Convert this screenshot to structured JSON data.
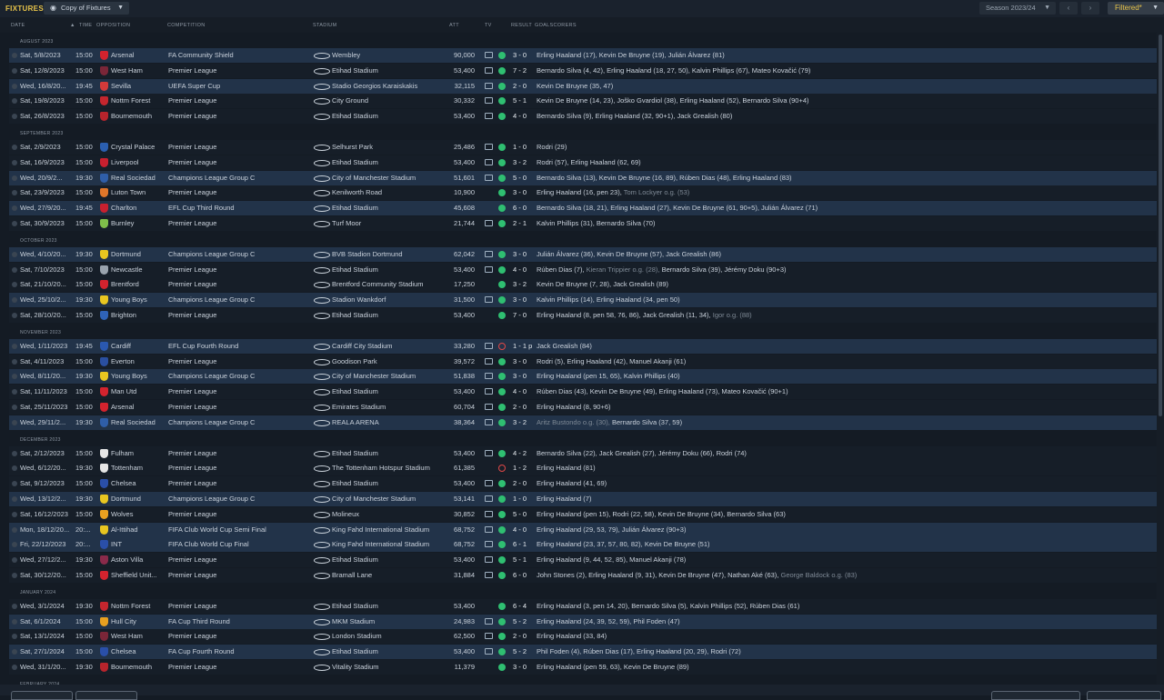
{
  "header": {
    "title": "FIXTURES",
    "view_selector": "Copy of Fixtures",
    "season_selector": "Season 2023/24",
    "filter_button": "Filtered*"
  },
  "columns": {
    "date": "DATE",
    "time": "TIME",
    "opposition": "OPPOSITION",
    "competition": "COMPETITION",
    "stadium": "STADIUM",
    "attendance": "ATT",
    "tv": "TV",
    "result": "RESULT",
    "goalscorers": "GOALSCORERS"
  },
  "months": [
    {
      "label": "AUGUST 2023",
      "fixtures": [
        {
          "date": "Sat, 5/8/2023",
          "time": "15:00",
          "opp": "Arsenal",
          "crest": "#d3232e",
          "comp": "FA Community Shield",
          "stadium": "Wembley",
          "att": "90,000",
          "tv": true,
          "outcome": "w",
          "score": "3 - 0",
          "scorers": "Erling Haaland (17), Kevin De Bruyne (19), Julián Álvarez (81)",
          "og": "",
          "scorers2": "",
          "hl": true
        },
        {
          "date": "Sat, 12/8/2023",
          "time": "15:00",
          "opp": "West Ham",
          "crest": "#7a2638",
          "comp": "Premier League",
          "stadium": "Etihad Stadium",
          "att": "53,400",
          "tv": true,
          "outcome": "w",
          "score": "7 - 2",
          "scorers": "Bernardo Silva (4, 42), Erling Haaland (18, 27, 50), Kalvin Phillips (67), Mateo Kovačić (79)",
          "og": "",
          "scorers2": "",
          "hl": false
        },
        {
          "date": "Wed, 16/8/20...",
          "time": "19:45",
          "opp": "Sevilla",
          "crest": "#d33a3a",
          "comp": "UEFA Super Cup",
          "stadium": "Stadio Georgios Karaiskakis",
          "att": "32,115",
          "tv": true,
          "outcome": "w",
          "score": "2 - 0",
          "scorers": "Kevin De Bruyne (35, 47)",
          "og": "",
          "scorers2": "",
          "hl": true
        },
        {
          "date": "Sat, 19/8/2023",
          "time": "15:00",
          "opp": "Nottm Forest",
          "crest": "#c4262e",
          "comp": "Premier League",
          "stadium": "City Ground",
          "att": "30,332",
          "tv": true,
          "outcome": "w",
          "score": "5 - 1",
          "scorers": "Kevin De Bruyne (14, 23), Joško Gvardiol (38), Erling Haaland (52), Bernardo Silva (90+4)",
          "og": "",
          "scorers2": "",
          "hl": false
        },
        {
          "date": "Sat, 26/8/2023",
          "time": "15:00",
          "opp": "Bournemouth",
          "crest": "#b8242c",
          "comp": "Premier League",
          "stadium": "Etihad Stadium",
          "att": "53,400",
          "tv": true,
          "outcome": "w",
          "score": "4 - 0",
          "scorers": "Bernardo Silva (9), Erling Haaland (32, 90+1), Jack Grealish (80)",
          "og": "",
          "scorers2": "",
          "hl": false
        }
      ]
    },
    {
      "label": "SEPTEMBER 2023",
      "fixtures": [
        {
          "date": "Sat, 2/9/2023",
          "time": "15:00",
          "opp": "Crystal Palace",
          "crest": "#2b5fb0",
          "comp": "Premier League",
          "stadium": "Selhurst Park",
          "att": "25,486",
          "tv": true,
          "outcome": "w",
          "score": "1 - 0",
          "scorers": "Rodri (29)",
          "og": "",
          "scorers2": "",
          "hl": false
        },
        {
          "date": "Sat, 16/9/2023",
          "time": "15:00",
          "opp": "Liverpool",
          "crest": "#c8202f",
          "comp": "Premier League",
          "stadium": "Etihad Stadium",
          "att": "53,400",
          "tv": true,
          "outcome": "w",
          "score": "3 - 2",
          "scorers": "Rodri (57), Erling Haaland (62, 69)",
          "og": "",
          "scorers2": "",
          "hl": false
        },
        {
          "date": "Wed, 20/9/2...",
          "time": "19:30",
          "opp": "Real Sociedad",
          "crest": "#2f5ea8",
          "comp": "Champions League Group C",
          "stadium": "City of Manchester Stadium",
          "att": "51,601",
          "tv": true,
          "outcome": "w",
          "score": "5 - 0",
          "scorers": "Bernardo Silva (13), Kevin De Bruyne (16, 89), Rúben Dias (48), Erling Haaland (83)",
          "og": "",
          "scorers2": "",
          "hl": true
        },
        {
          "date": "Sat, 23/9/2023",
          "time": "15:00",
          "opp": "Luton Town",
          "crest": "#e0772a",
          "comp": "Premier League",
          "stadium": "Kenilworth Road",
          "att": "10,900",
          "tv": false,
          "outcome": "w",
          "score": "3 - 0",
          "scorers": "Erling Haaland (16, pen 23),",
          "og": "Tom Lockyer o.g. (53)",
          "scorers2": "",
          "hl": false
        },
        {
          "date": "Wed, 27/9/20...",
          "time": "19:45",
          "opp": "Charlton",
          "crest": "#c8202f",
          "comp": "EFL Cup Third Round",
          "stadium": "Etihad Stadium",
          "att": "45,608",
          "tv": false,
          "outcome": "w",
          "score": "6 - 0",
          "scorers": "Bernardo Silva (18, 21), Erling Haaland (27), Kevin De Bruyne (61, 90+5), Julián Álvarez (71)",
          "og": "",
          "scorers2": "",
          "hl": true
        },
        {
          "date": "Sat, 30/9/2023",
          "time": "15:00",
          "opp": "Burnley",
          "crest": "#7fbf4a",
          "comp": "Premier League",
          "stadium": "Turf Moor",
          "att": "21,744",
          "tv": true,
          "outcome": "w",
          "score": "2 - 1",
          "scorers": "Kalvin Phillips (31), Bernardo Silva (70)",
          "og": "",
          "scorers2": "",
          "hl": false
        }
      ]
    },
    {
      "label": "OCTOBER 2023",
      "fixtures": [
        {
          "date": "Wed, 4/10/20...",
          "time": "19:30",
          "opp": "Dortmund",
          "crest": "#e8c620",
          "comp": "Champions League Group C",
          "stadium": "BVB Stadion Dortmund",
          "att": "62,042",
          "tv": true,
          "outcome": "w",
          "score": "3 - 0",
          "scorers": "Julián Álvarez (36), Kevin De Bruyne (57), Jack Grealish (86)",
          "og": "",
          "scorers2": "",
          "hl": true
        },
        {
          "date": "Sat, 7/10/2023",
          "time": "15:00",
          "opp": "Newcastle",
          "crest": "#9aa3ad",
          "comp": "Premier League",
          "stadium": "Etihad Stadium",
          "att": "53,400",
          "tv": true,
          "outcome": "w",
          "score": "4 - 0",
          "scorers": "Rúben Dias (7),",
          "og": "Kieran Trippier o.g. (28),",
          "scorers2": "Bernardo Silva (39), Jérémy Doku (90+3)",
          "hl": false
        },
        {
          "date": "Sat, 21/10/20...",
          "time": "15:00",
          "opp": "Brentford",
          "crest": "#d3232e",
          "comp": "Premier League",
          "stadium": "Brentford Community Stadium",
          "att": "17,250",
          "tv": false,
          "outcome": "w",
          "score": "3 - 2",
          "scorers": "Kevin De Bruyne (7, 28), Jack Grealish (89)",
          "og": "",
          "scorers2": "",
          "hl": false
        },
        {
          "date": "Wed, 25/10/2...",
          "time": "19:30",
          "opp": "Young Boys",
          "crest": "#e8c620",
          "comp": "Champions League Group C",
          "stadium": "Stadion Wankdorf",
          "att": "31,500",
          "tv": true,
          "outcome": "w",
          "score": "3 - 0",
          "scorers": "Kalvin Phillips (14), Erling Haaland (34, pen 50)",
          "og": "",
          "scorers2": "",
          "hl": true
        },
        {
          "date": "Sat, 28/10/20...",
          "time": "15:00",
          "opp": "Brighton",
          "crest": "#2f63b8",
          "comp": "Premier League",
          "stadium": "Etihad Stadium",
          "att": "53,400",
          "tv": false,
          "outcome": "w",
          "score": "7 - 0",
          "scorers": "Erling Haaland (8, pen 58, 76, 86), Jack Grealish (11, 34),",
          "og": "Igor o.g. (88)",
          "scorers2": "",
          "hl": false
        }
      ]
    },
    {
      "label": "NOVEMBER 2023",
      "fixtures": [
        {
          "date": "Wed, 1/11/2023",
          "time": "19:45",
          "opp": "Cardiff",
          "crest": "#2a58b0",
          "comp": "EFL Cup Fourth Round",
          "stadium": "Cardiff City Stadium",
          "att": "33,280",
          "tv": true,
          "outcome": "l",
          "score": "1 - 1 p",
          "scorers": "Jack Grealish (84)",
          "og": "",
          "scorers2": "",
          "hl": true
        },
        {
          "date": "Sat, 4/11/2023",
          "time": "15:00",
          "opp": "Everton",
          "crest": "#2a4fa0",
          "comp": "Premier League",
          "stadium": "Goodison Park",
          "att": "39,572",
          "tv": true,
          "outcome": "w",
          "score": "3 - 0",
          "scorers": "Rodri (5), Erling Haaland (42), Manuel Akanji (61)",
          "og": "",
          "scorers2": "",
          "hl": false
        },
        {
          "date": "Wed, 8/11/20...",
          "time": "19:30",
          "opp": "Young Boys",
          "crest": "#e8c620",
          "comp": "Champions League Group C",
          "stadium": "City of Manchester Stadium",
          "att": "51,838",
          "tv": true,
          "outcome": "w",
          "score": "3 - 0",
          "scorers": "Erling Haaland (pen 15, 65), Kalvin Phillips (40)",
          "og": "",
          "scorers2": "",
          "hl": true
        },
        {
          "date": "Sat, 11/11/2023",
          "time": "15:00",
          "opp": "Man Utd",
          "crest": "#d3232e",
          "comp": "Premier League",
          "stadium": "Etihad Stadium",
          "att": "53,400",
          "tv": true,
          "outcome": "w",
          "score": "4 - 0",
          "scorers": "Rúben Dias (43), Kevin De Bruyne (49), Erling Haaland (73), Mateo Kovačić (90+1)",
          "og": "",
          "scorers2": "",
          "hl": false
        },
        {
          "date": "Sat, 25/11/2023",
          "time": "15:00",
          "opp": "Arsenal",
          "crest": "#d3232e",
          "comp": "Premier League",
          "stadium": "Emirates Stadium",
          "att": "60,704",
          "tv": true,
          "outcome": "w",
          "score": "2 - 0",
          "scorers": "Erling Haaland (8, 90+6)",
          "og": "",
          "scorers2": "",
          "hl": false
        },
        {
          "date": "Wed, 29/11/2...",
          "time": "19:30",
          "opp": "Real Sociedad",
          "crest": "#2f5ea8",
          "comp": "Champions League Group C",
          "stadium": "REALA ARENA",
          "att": "38,364",
          "tv": true,
          "outcome": "w",
          "score": "3 - 2",
          "scorers": "",
          "og": "Aritz Bustondo o.g. (30),",
          "scorers2": "Bernardo Silva (37, 59)",
          "hl": true
        }
      ]
    },
    {
      "label": "DECEMBER 2023",
      "fixtures": [
        {
          "date": "Sat, 2/12/2023",
          "time": "15:00",
          "opp": "Fulham",
          "crest": "#e6e6e6",
          "comp": "Premier League",
          "stadium": "Etihad Stadium",
          "att": "53,400",
          "tv": true,
          "outcome": "w",
          "score": "4 - 2",
          "scorers": "Bernardo Silva (22), Jack Grealish (27), Jérémy Doku (66), Rodri (74)",
          "og": "",
          "scorers2": "",
          "hl": false
        },
        {
          "date": "Wed, 6/12/20...",
          "time": "19:30",
          "opp": "Tottenham",
          "crest": "#e6e6e6",
          "comp": "Premier League",
          "stadium": "The Tottenham Hotspur Stadium",
          "att": "61,385",
          "tv": false,
          "outcome": "l",
          "score": "1 - 2",
          "scorers": "Erling Haaland (81)",
          "og": "",
          "scorers2": "",
          "hl": false
        },
        {
          "date": "Sat, 9/12/2023",
          "time": "15:00",
          "opp": "Chelsea",
          "crest": "#2a4fa8",
          "comp": "Premier League",
          "stadium": "Etihad Stadium",
          "att": "53,400",
          "tv": true,
          "outcome": "w",
          "score": "2 - 0",
          "scorers": "Erling Haaland (41, 69)",
          "og": "",
          "scorers2": "",
          "hl": false
        },
        {
          "date": "Wed, 13/12/2...",
          "time": "19:30",
          "opp": "Dortmund",
          "crest": "#e8c620",
          "comp": "Champions League Group C",
          "stadium": "City of Manchester Stadium",
          "att": "53,141",
          "tv": true,
          "outcome": "w",
          "score": "1 - 0",
          "scorers": "Erling Haaland (7)",
          "og": "",
          "scorers2": "",
          "hl": true
        },
        {
          "date": "Sat, 16/12/2023",
          "time": "15:00",
          "opp": "Wolves",
          "crest": "#e8a020",
          "comp": "Premier League",
          "stadium": "Molineux",
          "att": "30,852",
          "tv": true,
          "outcome": "w",
          "score": "5 - 0",
          "scorers": "Erling Haaland (pen 15), Rodri (22, 58), Kevin De Bruyne (34), Bernardo Silva (63)",
          "og": "",
          "scorers2": "",
          "hl": false
        },
        {
          "date": "Mon, 18/12/20...",
          "time": "20:...",
          "opp": "Al-Ittihad",
          "crest": "#e8c620",
          "comp": "FIFA Club World Cup Semi Final",
          "stadium": "King Fahd International Stadium",
          "att": "68,752",
          "tv": true,
          "outcome": "w",
          "score": "4 - 0",
          "scorers": "Erling Haaland (29, 53, 79), Julián Álvarez (90+3)",
          "og": "",
          "scorers2": "",
          "hl": true
        },
        {
          "date": "Fri, 22/12/2023",
          "time": "20:...",
          "opp": "INT",
          "crest": "#2a4fa8",
          "comp": "FIFA Club World Cup Final",
          "stadium": "King Fahd International Stadium",
          "att": "68,752",
          "tv": true,
          "outcome": "w",
          "score": "6 - 1",
          "scorers": "Erling Haaland (23, 37, 57, 80, 82), Kevin De Bruyne (51)",
          "og": "",
          "scorers2": "",
          "hl": true
        },
        {
          "date": "Wed, 27/12/2...",
          "time": "19:30",
          "opp": "Aston Villa",
          "crest": "#8a2a4a",
          "comp": "Premier League",
          "stadium": "Etihad Stadium",
          "att": "53,400",
          "tv": true,
          "outcome": "w",
          "score": "5 - 1",
          "scorers": "Erling Haaland (9, 44, 52, 85), Manuel Akanji (78)",
          "og": "",
          "scorers2": "",
          "hl": false
        },
        {
          "date": "Sat, 30/12/20...",
          "time": "15:00",
          "opp": "Sheffield Unit...",
          "crest": "#d3232e",
          "comp": "Premier League",
          "stadium": "Bramall Lane",
          "att": "31,884",
          "tv": true,
          "outcome": "w",
          "score": "6 - 0",
          "scorers": "John Stones (2), Erling Haaland (9, 31), Kevin De Bruyne (47), Nathan Aké (63),",
          "og": "George Baldock o.g. (83)",
          "scorers2": "",
          "hl": false
        }
      ]
    },
    {
      "label": "JANUARY 2024",
      "fixtures": [
        {
          "date": "Wed, 3/1/2024",
          "time": "19:30",
          "opp": "Nottm Forest",
          "crest": "#c4262e",
          "comp": "Premier League",
          "stadium": "Etihad Stadium",
          "att": "53,400",
          "tv": false,
          "outcome": "w",
          "score": "6 - 4",
          "scorers": "Erling Haaland (3, pen 14, 20), Bernardo Silva (5), Kalvin Phillips (52), Rúben Dias (61)",
          "og": "",
          "scorers2": "",
          "hl": false
        },
        {
          "date": "Sat, 6/1/2024",
          "time": "15:00",
          "opp": "Hull City",
          "crest": "#e8a020",
          "comp": "FA Cup Third Round",
          "stadium": "MKM Stadium",
          "att": "24,983",
          "tv": true,
          "outcome": "w",
          "score": "5 - 2",
          "scorers": "Erling Haaland (24, 39, 52, 59), Phil Foden (47)",
          "og": "",
          "scorers2": "",
          "hl": true
        },
        {
          "date": "Sat, 13/1/2024",
          "time": "15:00",
          "opp": "West Ham",
          "crest": "#7a2638",
          "comp": "Premier League",
          "stadium": "London Stadium",
          "att": "62,500",
          "tv": true,
          "outcome": "w",
          "score": "2 - 0",
          "scorers": "Erling Haaland (33, 84)",
          "og": "",
          "scorers2": "",
          "hl": false
        },
        {
          "date": "Sat, 27/1/2024",
          "time": "15:00",
          "opp": "Chelsea",
          "crest": "#2a4fa8",
          "comp": "FA Cup Fourth Round",
          "stadium": "Etihad Stadium",
          "att": "53,400",
          "tv": true,
          "outcome": "w",
          "score": "5 - 2",
          "scorers": "Phil Foden (4), Rúben Dias (17), Erling Haaland (20, 29), Rodri (72)",
          "og": "",
          "scorers2": "",
          "hl": true
        },
        {
          "date": "Wed, 31/1/20...",
          "time": "19:30",
          "opp": "Bournemouth",
          "crest": "#b8242c",
          "comp": "Premier League",
          "stadium": "Vitality Stadium",
          "att": "11,379",
          "tv": false,
          "outcome": "w",
          "score": "3 - 0",
          "scorers": "Erling Haaland (pen 59, 63), Kevin De Bruyne (89)",
          "og": "",
          "scorers2": "",
          "hl": false
        }
      ]
    },
    {
      "label": "FEBRUARY 2024",
      "fixtures": []
    }
  ]
}
